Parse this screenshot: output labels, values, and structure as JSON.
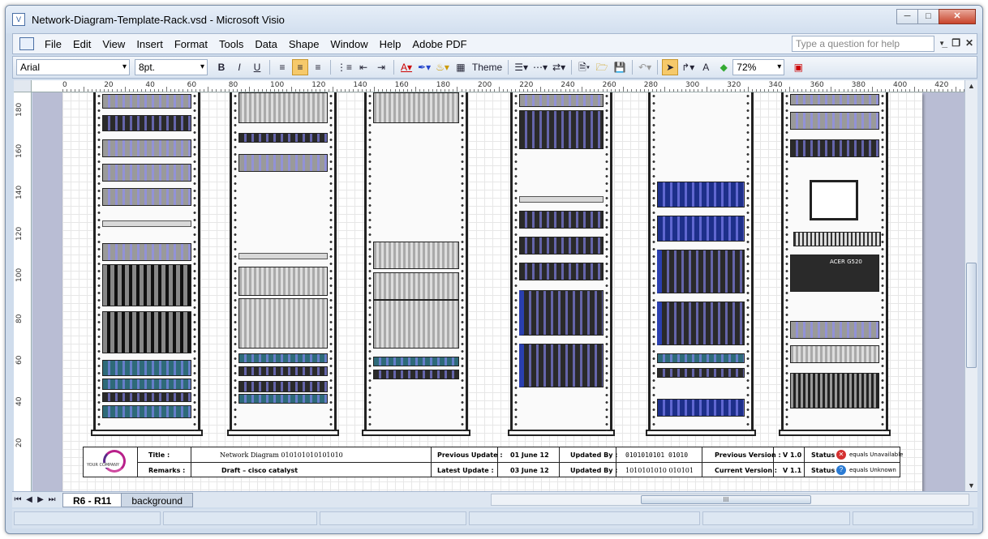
{
  "window": {
    "title": "Network-Diagram-Template-Rack.vsd - Microsoft Visio",
    "min": "─",
    "max": "□",
    "close": "✕"
  },
  "menu": {
    "items": [
      "File",
      "Edit",
      "View",
      "Insert",
      "Format",
      "Tools",
      "Data",
      "Shape",
      "Window",
      "Help",
      "Adobe PDF"
    ],
    "ask_placeholder": "Type a question for help",
    "doc_min": "_",
    "doc_restore": "❐",
    "doc_close": "✕"
  },
  "toolbar": {
    "font": "Arial",
    "size": "8pt.",
    "bold": "B",
    "italic": "I",
    "underline": "U",
    "theme": "Theme",
    "zoom": "72%",
    "text_tool": "A"
  },
  "ruler": {
    "h_ticks": [
      "0",
      "20",
      "40",
      "60",
      "80",
      "100",
      "120",
      "140",
      "160",
      "180",
      "200",
      "220",
      "240",
      "260",
      "280",
      "300",
      "320",
      "340",
      "360",
      "380",
      "400",
      "420"
    ],
    "v_ticks": [
      "180",
      "160",
      "140",
      "120",
      "100",
      "80",
      "60",
      "40",
      "20"
    ]
  },
  "monitor_label": "ACER G520",
  "title_block": {
    "logo_text": "YOUR COMPANY",
    "title_label": "Title :",
    "title_value": "Network Diagram 010101010101010",
    "remarks_label": "Remarks :",
    "remarks_value": "Draft – cisco catalyst",
    "prev_update_label": "Previous Update :",
    "prev_update_value": "01 June 12",
    "latest_update_label": "Latest Update :",
    "latest_update_value": "03 June 12",
    "updated_by_label": "Updated By :",
    "updated_by_value1": "0101010101 01010",
    "updated_by_value2": "1010101010 010101",
    "prev_version_label": "Previous Version :",
    "prev_version_value": "V 1.0",
    "current_version_label": "Current Version :",
    "current_version_value": "V 1.1",
    "status_label": "Status",
    "status_unavailable": "equals Unavailable",
    "status_unknown": "equals Unknown"
  },
  "tabs": [
    "R6 - R11",
    "background"
  ],
  "nav": {
    "first": "⏮",
    "prev": "◀",
    "next": "▶",
    "last": "⏭"
  },
  "scroll_grip": "III"
}
